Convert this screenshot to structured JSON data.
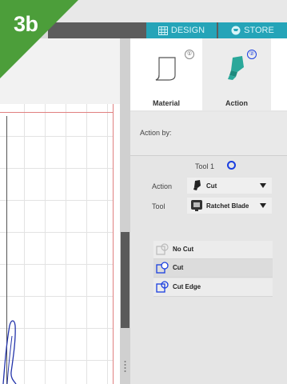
{
  "badge": {
    "text": "3b"
  },
  "header": {
    "tabs": [
      {
        "label": "DESIGN",
        "icon": "grid-icon"
      },
      {
        "label": "STORE",
        "icon": "cart-icon"
      }
    ]
  },
  "steps": [
    {
      "label": "Material",
      "number": "①",
      "icon": "material-icon"
    },
    {
      "label": "Action",
      "number": "②",
      "icon": "blade-icon"
    }
  ],
  "action_by_label": "Action by:",
  "tool_section": {
    "title": "Tool 1",
    "action_label": "Action",
    "action_value": "Cut",
    "tool_label": "Tool",
    "tool_value": "Ratchet Blade"
  },
  "cut_options": [
    {
      "label": "No Cut",
      "icon": "no-cut-icon"
    },
    {
      "label": "Cut",
      "icon": "cut-icon"
    },
    {
      "label": "Cut Edge",
      "icon": "cut-edge-icon"
    }
  ],
  "colors": {
    "accent": "#25a4b8",
    "badge": "#4c9e3a",
    "tool_ring": "#1a3fe0",
    "blade": "#2aa89a"
  }
}
